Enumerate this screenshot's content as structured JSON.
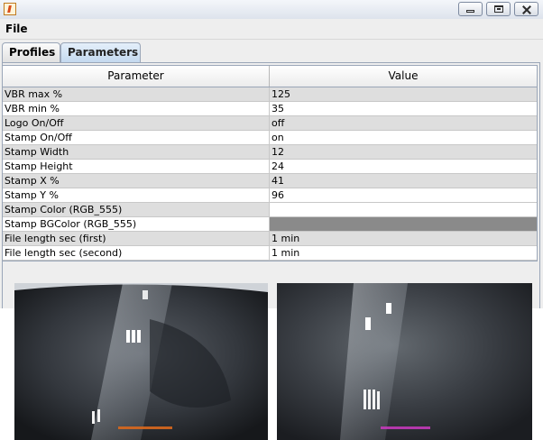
{
  "window": {
    "app_icon": "java-cup-icon",
    "buttons": [
      "minimize",
      "maximize",
      "close"
    ]
  },
  "menu": {
    "file": "File"
  },
  "tabs": [
    {
      "label": "Profiles",
      "selected": false
    },
    {
      "label": "Parameters",
      "selected": true
    }
  ],
  "table": {
    "headers": [
      "Parameter",
      "Value"
    ],
    "rows": [
      {
        "param": "VBR max %",
        "value": "125"
      },
      {
        "param": "VBR min %",
        "value": "35"
      },
      {
        "param": "Logo On/Off",
        "value": "off"
      },
      {
        "param": "Stamp On/Off",
        "value": "on"
      },
      {
        "param": "Stamp Width",
        "value": "12"
      },
      {
        "param": "Stamp Height",
        "value": "24"
      },
      {
        "param": "Stamp X %",
        "value": "41"
      },
      {
        "param": "Stamp Y %",
        "value": "96"
      },
      {
        "param": "Stamp Color (RGB_555)",
        "value": ""
      },
      {
        "param": "Stamp BGColor (RGB_555)",
        "value": ""
      },
      {
        "param": "File length sec (first)",
        "value": "1 min"
      },
      {
        "param": "File length sec (second)",
        "value": "1 min"
      }
    ],
    "color_swatches": {
      "stamp_color": "#ffffff",
      "stamp_bgcolor": "#8a8a8a"
    }
  },
  "previews": [
    {
      "name": "camera-preview-1",
      "stamp_color": "#d8681e"
    },
    {
      "name": "camera-preview-2",
      "stamp_color": "#c23ab8"
    }
  ]
}
